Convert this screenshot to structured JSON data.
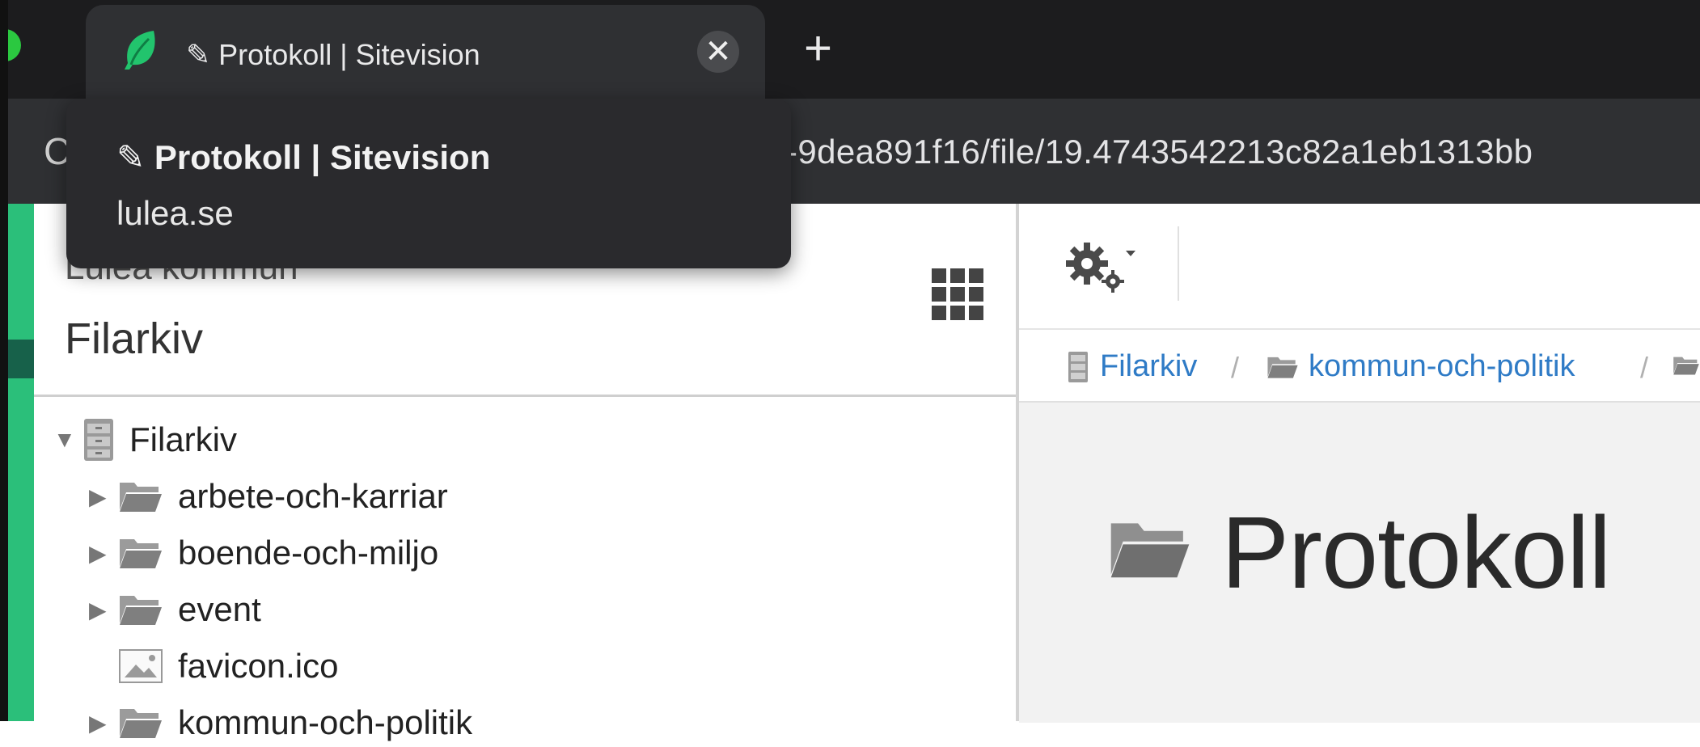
{
  "browser": {
    "tab": {
      "title": "✎ Protokoll | Sitevision",
      "close_glyph": "✕",
      "favicon": "leaf-icon"
    },
    "new_tab_glyph": "+",
    "reload_glyph": "C",
    "address_bar": {
      "url_visible": "-9dea891f16/file/19.4743542213c82a1eb1313bb"
    },
    "tooltip": {
      "title": "✎ Protokoll | Sitevision",
      "domain": "lulea.se"
    }
  },
  "left_panel": {
    "org_name": "Luleå kommun",
    "title": "Filarkiv",
    "apps_icon": "apps-grid-icon",
    "tree": {
      "root": {
        "label": "Filarkiv",
        "caret": "▼",
        "icon": "file-archive-icon"
      },
      "items": [
        {
          "label": "arbete-och-karriar",
          "caret": "▶",
          "type": "folder"
        },
        {
          "label": "boende-och-miljo",
          "caret": "▶",
          "type": "folder"
        },
        {
          "label": "event",
          "caret": "▶",
          "type": "folder"
        },
        {
          "label": "favicon.ico",
          "caret": "",
          "type": "image"
        },
        {
          "label": "kommun-och-politik",
          "caret": "▶",
          "type": "folder"
        }
      ]
    }
  },
  "right_panel": {
    "toolbar": {
      "gear_menu": "gear-dropdown-icon"
    },
    "breadcrumb": {
      "items": [
        "Filarkiv",
        "kommun-och-politik"
      ],
      "separator": "/"
    },
    "heading": "Protokoll"
  },
  "colors": {
    "link": "#2f7bc6",
    "brand_green": "#2bbf7a",
    "chrome_dark": "#1c1c1e",
    "chrome_tab": "#2f3033"
  }
}
